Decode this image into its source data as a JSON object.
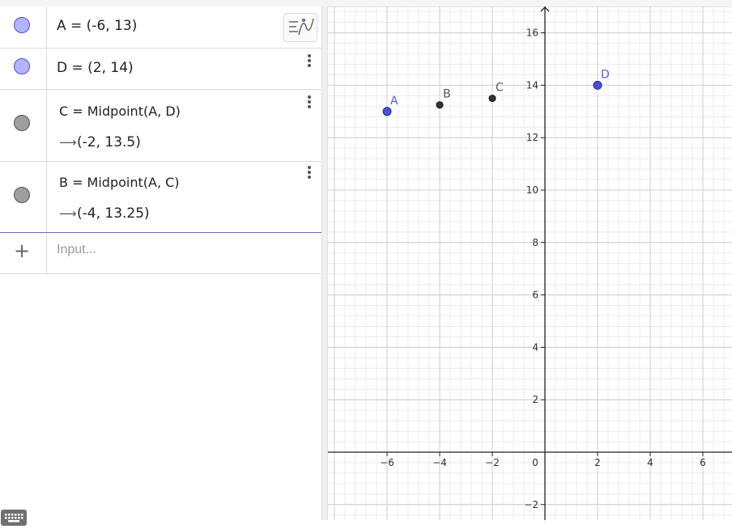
{
  "algebra": {
    "objects": [
      {
        "definition": "A = (-6, 13)",
        "type": "free"
      },
      {
        "definition": "D = (2, 14)",
        "type": "free"
      },
      {
        "definition": "C = Midpoint(A, D)",
        "value": "(-2, 13.5)",
        "type": "dependent"
      },
      {
        "definition": "B = Midpoint(A, C)",
        "value": "(-4, 13.25)",
        "type": "dependent"
      }
    ],
    "input_placeholder": "Input...",
    "input_value": ""
  },
  "graphics": {
    "x_ticks": [
      -6,
      -4,
      -2,
      0,
      2,
      4,
      6
    ],
    "y_ticks": [
      -2,
      2,
      4,
      6,
      8,
      10,
      12,
      14,
      16
    ],
    "tick_labels": {
      "x": [
        "−6",
        "−4",
        "−2",
        "0",
        "2",
        "4",
        "6"
      ],
      "y": [
        "−2",
        "2",
        "4",
        "6",
        "8",
        "10",
        "12",
        "14",
        "16"
      ]
    },
    "points": [
      {
        "name": "A",
        "x": -6,
        "y": 13,
        "color": "#4d4dd9",
        "kind": "free"
      },
      {
        "name": "B",
        "x": -4,
        "y": 13.25,
        "color": "#333333",
        "kind": "dependent"
      },
      {
        "name": "C",
        "x": -2,
        "y": 13.5,
        "color": "#333333",
        "kind": "dependent"
      },
      {
        "name": "D",
        "x": 2,
        "y": 14,
        "color": "#4d4dd9",
        "kind": "free"
      }
    ],
    "colors": {
      "free_label": "#5a5ae6",
      "dependent_label": "#555555",
      "axis": "#222222",
      "grid_major": "#cfcfcf",
      "grid_minor": "#ececec"
    }
  },
  "icons": {
    "style_toggle": "graphing-style-icon",
    "keyboard": "keyboard-icon",
    "more": "more-vertical-icon",
    "add": "plus-icon"
  }
}
